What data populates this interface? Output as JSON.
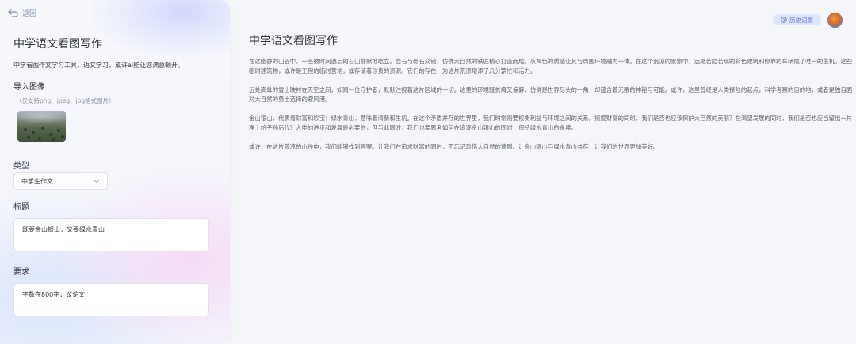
{
  "sidebar": {
    "back_label": "返回",
    "title": "中学语文看图写作",
    "description": "中学看图作文学习工具，语文学习，或许ai能让您满意顿开。",
    "upload": {
      "label": "导入图像",
      "hint": "（仅支持png、jpeg、jpg格式图片）"
    },
    "type": {
      "label": "类型",
      "value": "中学生作文"
    },
    "topic": {
      "label": "标题",
      "value": "既要金山银山，又要绿水青山"
    },
    "requirement": {
      "label": "要求",
      "value": "字数在800字，议论文"
    }
  },
  "header": {
    "history_label": "历史记录"
  },
  "main": {
    "title": "中学语文看图写作",
    "paragraphs": [
      "在这幽静的山谷中，一座被时间遗忘的石山静默地屹立。岩石与砾石交错，仿佛大自然的铁匠精心打造而成。灰褐色的质感让其与周围环境融为一体。在这个荒凉的景象中，远处若隐若现的彩色建筑和停靠的车辆成了唯一的生机。这些临时建筑物，或许是工程的临时营地，或存储着珍贵的资源。它们的存在，为这片荒凉增添了几分繁忙和活力。",
      "远处高耸的雪山映衬在天空之间，如同一位守护者，默默注视着这片区域的一切。这里的环境既贫瘠又偏僻，仿佛是世界尽头的一角，却蕴含着无限的神秘与可能。或许，这里曾经是人类探险的起点，科学考察的目的地，或者是独自面对大自然的勇士选择的避风港。",
      "金山银山，代表着财富和珍宝；绿水青山，意味着清新和生机。在这个矛盾并存的世界里，我们时常需要权衡利益与环境之间的关系。挖掘财富的同时，我们是否也应该保护大自然的美丽？在渴望发展的同时，我们是否也应当留出一片净土给子孙后代？人类的进步和发展是必要的，但与此同时，我们也要思考如何在追逐金山银山的同时，保持绿水青山的永续。",
      "或许，在这片荒凉的山谷中，我们能够找到答案。让我们在追求财富的同时，不忘记珍惜大自然的馈赠。让金山银山与绿水青山共存，让我们的世界更加美好。"
    ]
  }
}
